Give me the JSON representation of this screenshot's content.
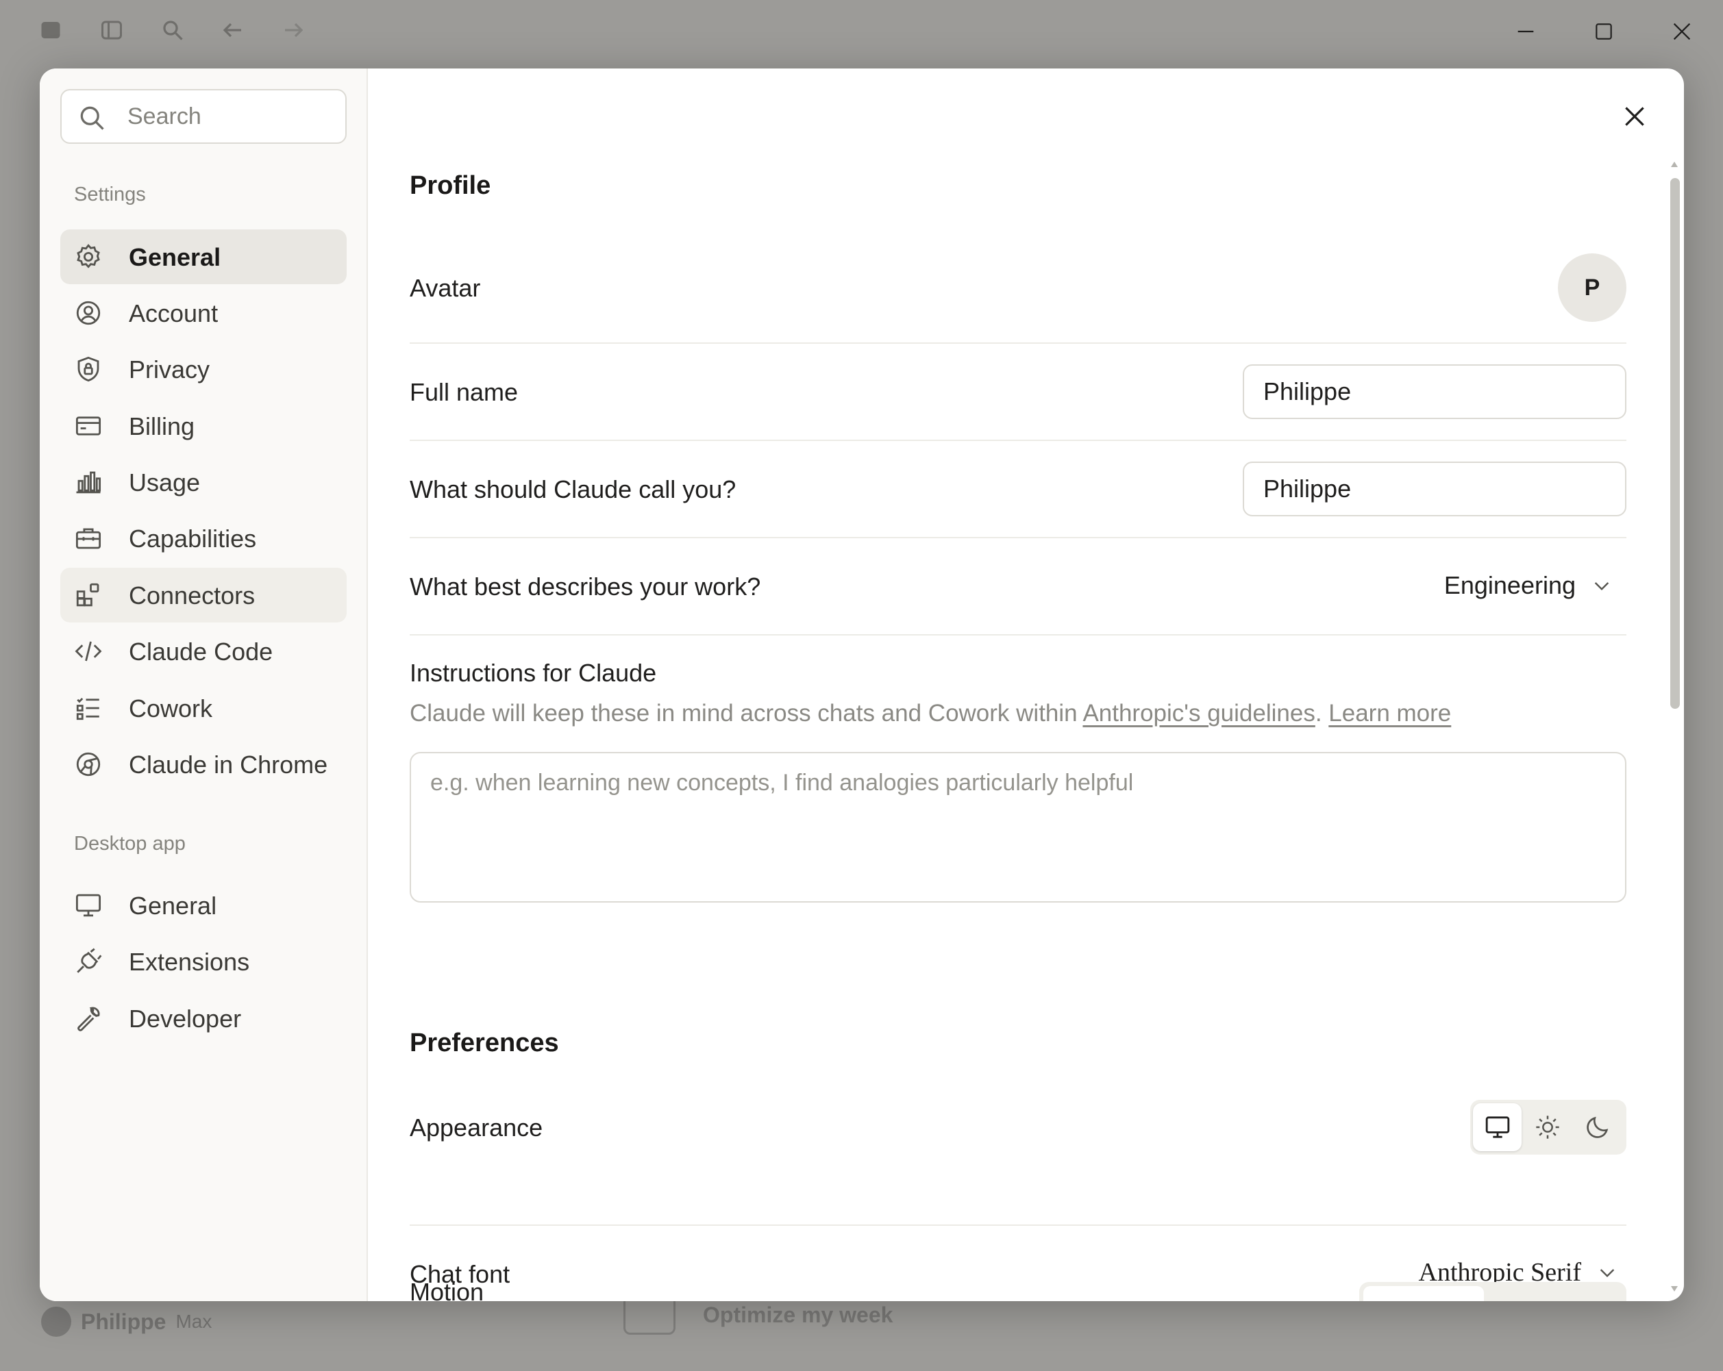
{
  "background": {
    "user_name": "Philippe",
    "plan": "Max",
    "task_title": "Optimize my week"
  },
  "search": {
    "placeholder": "Search"
  },
  "sidebar": {
    "settings_label": "Settings",
    "settings_items": [
      {
        "label": "General",
        "icon": "gear-icon",
        "state": "active"
      },
      {
        "label": "Account",
        "icon": "user-circle-icon"
      },
      {
        "label": "Privacy",
        "icon": "shield-lock-icon"
      },
      {
        "label": "Billing",
        "icon": "credit-card-icon"
      },
      {
        "label": "Usage",
        "icon": "bar-chart-icon"
      },
      {
        "label": "Capabilities",
        "icon": "briefcase-icon"
      },
      {
        "label": "Connectors",
        "icon": "grid-plus-icon",
        "state": "hover"
      },
      {
        "label": "Claude Code",
        "icon": "code-icon"
      },
      {
        "label": "Cowork",
        "icon": "checklist-icon"
      },
      {
        "label": "Claude in Chrome",
        "icon": "globe-icon"
      }
    ],
    "desktop_label": "Desktop app",
    "desktop_items": [
      {
        "label": "General",
        "icon": "monitor-icon"
      },
      {
        "label": "Extensions",
        "icon": "plug-icon"
      },
      {
        "label": "Developer",
        "icon": "wrench-icon"
      }
    ]
  },
  "profile": {
    "heading": "Profile",
    "avatar_label": "Avatar",
    "avatar_initial": "P",
    "full_name_label": "Full name",
    "full_name_value": "Philippe",
    "call_you_label": "What should Claude call you?",
    "call_you_value": "Philippe",
    "work_label": "What best describes your work?",
    "work_value": "Engineering",
    "instructions_label": "Instructions for Claude",
    "instructions_desc": "Claude will keep these in mind across chats and Cowork within ",
    "guidelines_link": "Anthropic's guidelines",
    "learn_more_link": "Learn more",
    "instructions_placeholder": "e.g. when learning new concepts, I find analogies particularly helpful"
  },
  "preferences": {
    "heading": "Preferences",
    "appearance_label": "Appearance",
    "appearance_options": [
      "system-monitor-icon",
      "sun-icon",
      "moon-icon"
    ],
    "appearance_selected": "system-monitor-icon",
    "chat_font_label": "Chat font",
    "chat_font_value": "Anthropic Serif",
    "motion_label": "Motion"
  }
}
